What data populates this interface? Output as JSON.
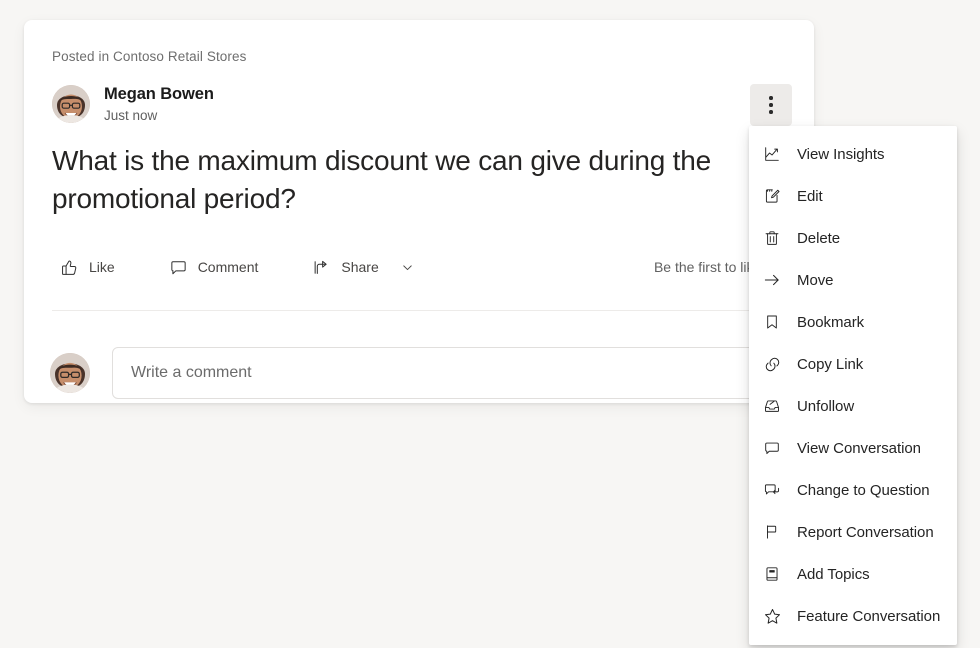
{
  "background_color": "#F7F6F4",
  "card": {
    "posted_in": "Posted in Contoso Retail Stores",
    "author": {
      "name": "Megan Bowen",
      "timestamp": "Just now",
      "avatar_icon": "user-avatar-photo"
    },
    "overflow_button": {
      "icon": "more-vertical-icon",
      "label": "More options"
    },
    "body_text": "What is the maximum discount we can give during the promotional period?",
    "actions": [
      {
        "label": "Like",
        "icon": "thumbs-up-icon"
      },
      {
        "label": "Comment",
        "icon": "comment-bubble-icon"
      },
      {
        "label": "Share",
        "icon": "share-arrow-icon",
        "has_chevron": true,
        "chevron_icon": "chevron-down-icon"
      }
    ],
    "like_prompt": "Be the first to like this",
    "comment_box": {
      "placeholder": "Write a comment",
      "value": "",
      "avatar_icon": "user-avatar-photo"
    }
  },
  "context_menu": {
    "items": [
      {
        "label": "View Insights",
        "icon": "insights-chart-icon"
      },
      {
        "label": "Edit",
        "icon": "edit-pencil-icon"
      },
      {
        "label": "Delete",
        "icon": "trash-icon"
      },
      {
        "label": "Move",
        "icon": "arrow-right-icon"
      },
      {
        "label": "Bookmark",
        "icon": "bookmark-icon"
      },
      {
        "label": "Copy Link",
        "icon": "link-icon"
      },
      {
        "label": "Unfollow",
        "icon": "unfollow-inbox-icon"
      },
      {
        "label": "View Conversation",
        "icon": "conversation-bubble-icon"
      },
      {
        "label": "Change to Question",
        "icon": "change-to-question-icon"
      },
      {
        "label": "Report Conversation",
        "icon": "flag-icon"
      },
      {
        "label": "Add Topics",
        "icon": "topics-book-icon"
      },
      {
        "label": "Feature Conversation",
        "icon": "star-icon"
      }
    ]
  }
}
